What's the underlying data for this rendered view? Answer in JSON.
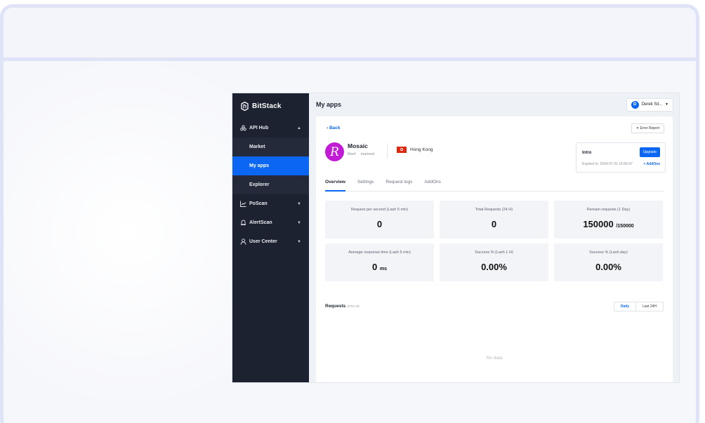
{
  "brand": {
    "name": "BitStack"
  },
  "sidebar": {
    "items": [
      {
        "label": "API Hub",
        "icon": "api-hub-icon",
        "expanded": true,
        "children": [
          {
            "label": "Market"
          },
          {
            "label": "My apps",
            "active": true
          },
          {
            "label": "Explorer"
          }
        ]
      },
      {
        "label": "PoScan",
        "icon": "chart-line-icon"
      },
      {
        "label": "AlertScan",
        "icon": "bell-icon"
      },
      {
        "label": "User Center",
        "icon": "user-icon"
      }
    ]
  },
  "header": {
    "title": "My apps",
    "user": {
      "initial": "D",
      "name": "Derek Sil..."
    }
  },
  "app": {
    "back_label": "Back",
    "error_report_label": "Error Report",
    "name": "Mosaic",
    "chain": "Reef",
    "network": "mainnet",
    "region": "Hong Kong",
    "plan": {
      "name": "Intro",
      "upgrade_label": "Upgrade",
      "expires": "Expired to: 2024-07-31 15:56:47",
      "addons_label": "+ AddOns"
    }
  },
  "tabs": [
    {
      "label": "Overview",
      "active": true
    },
    {
      "label": "Settings"
    },
    {
      "label": "Request logs"
    },
    {
      "label": "AddOns"
    }
  ],
  "stats": [
    {
      "label": "Request per second (Lash 5 min)",
      "value": "0",
      "suffix": ""
    },
    {
      "label": "Total Requests (24 H)",
      "value": "0",
      "suffix": ""
    },
    {
      "label": "Remain requests (1 Day)",
      "value": "150000",
      "suffix": "/150000"
    },
    {
      "label": "Average response time (Lash 5 min)",
      "value": "0",
      "suffix": "ms"
    },
    {
      "label": "Success % (Lash 1 H)",
      "value": "0.00%",
      "suffix": ""
    },
    {
      "label": "Success % (Lash day)",
      "value": "0.00%",
      "suffix": ""
    }
  ],
  "requests": {
    "title": "Requests",
    "timezone": "(UTC+0)",
    "toggle": [
      "Daily",
      "Last 24H"
    ],
    "empty_text": "No data"
  },
  "colors": {
    "accent": "#0a66f3",
    "sidebar": "#1d2230",
    "app_logo": "#c21bd5"
  }
}
